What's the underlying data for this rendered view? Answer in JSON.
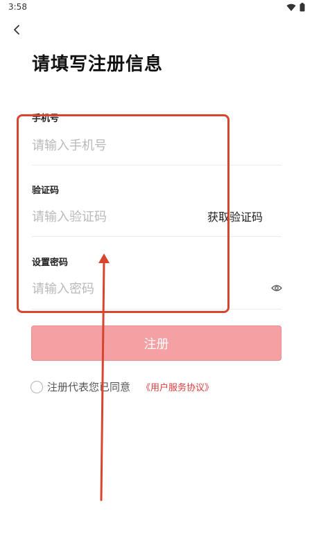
{
  "status_bar": {
    "time": "3:58",
    "icons": [
      "wifi-icon",
      "battery-icon"
    ]
  },
  "header": {
    "back_icon": "chevron-left-icon",
    "title": "请填写注册信息"
  },
  "form": {
    "phone": {
      "label": "手机号",
      "placeholder": "请输入手机号",
      "value": ""
    },
    "code": {
      "label": "验证码",
      "placeholder": "请输入验证码",
      "value": "",
      "get_code_label": "获取验证码"
    },
    "password": {
      "label": "设置密码",
      "placeholder": "请输入密码",
      "value": "",
      "toggle_icon": "eye-icon"
    },
    "submit_label": "注册"
  },
  "agreement": {
    "checked": false,
    "text": "注册代表您已同意",
    "link_text": "《用户服务协议》"
  },
  "colors": {
    "accent": "#e03a3a",
    "button_bg": "#f5a0a2",
    "annotation": "#d8452e"
  }
}
